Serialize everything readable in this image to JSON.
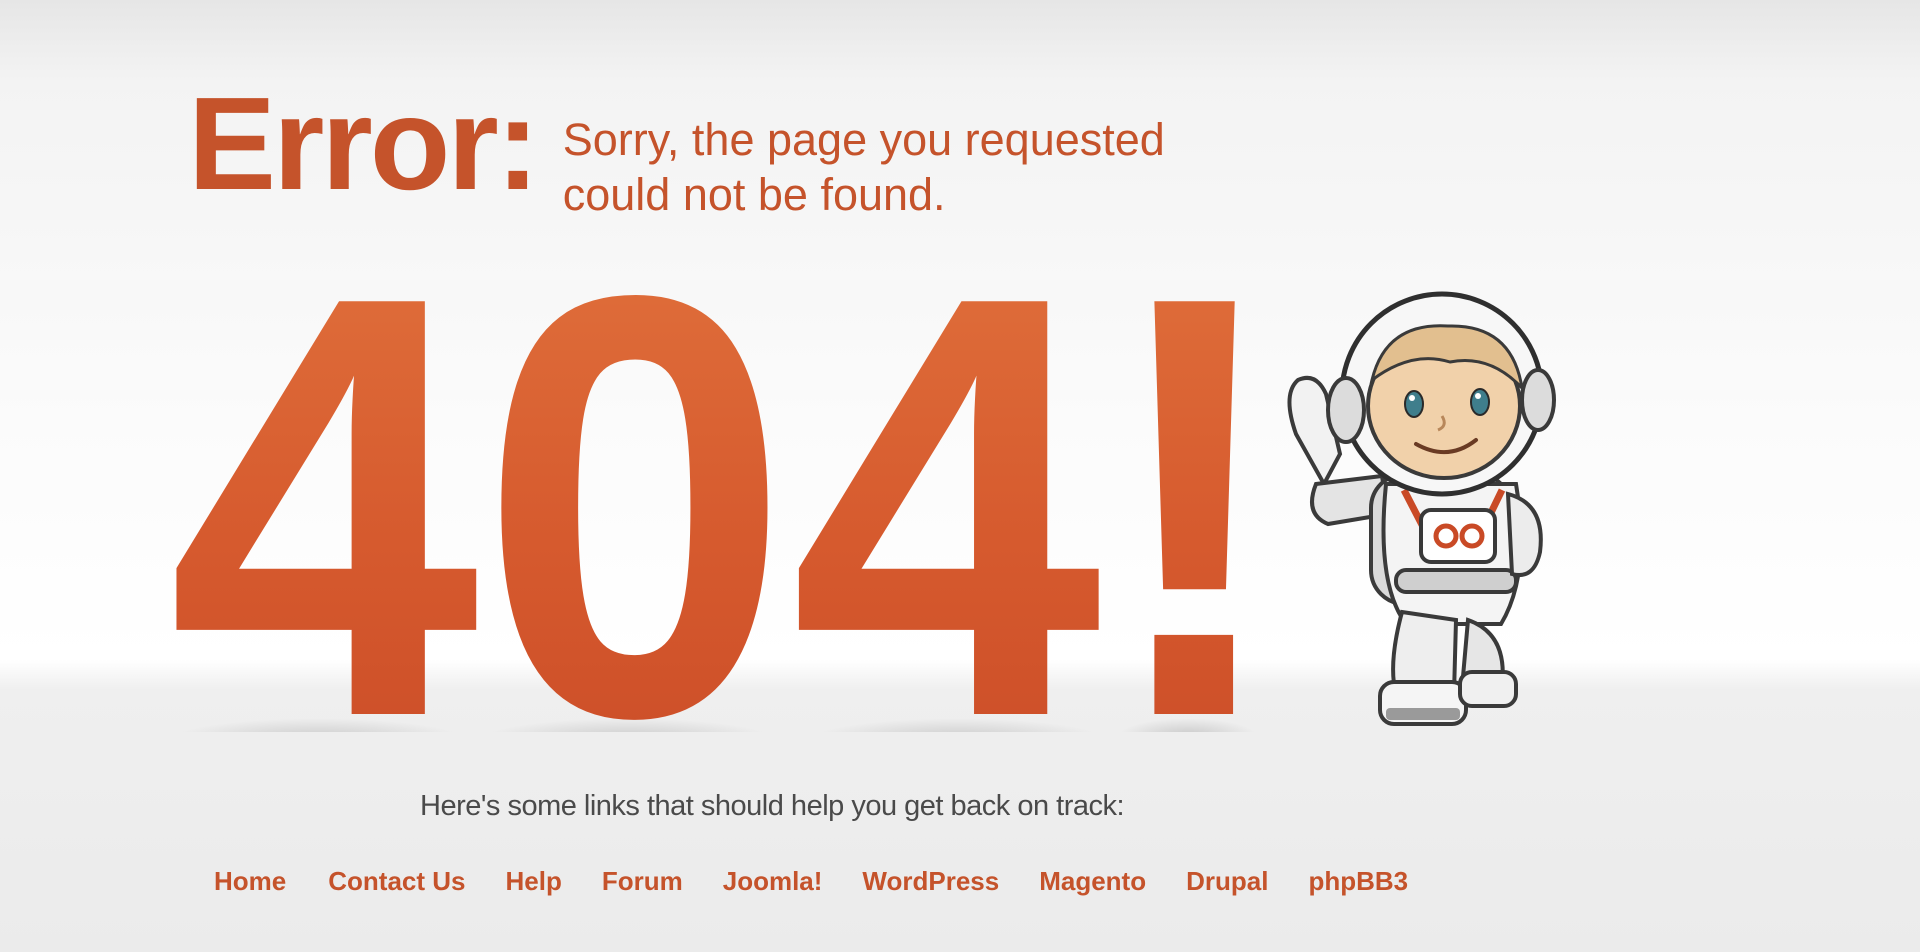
{
  "error": {
    "label": "Error:",
    "message_line1": "Sorry, the page you requested",
    "message_line2": "could not be found."
  },
  "hero": {
    "code": "404!",
    "illustration": "astronaut-mascot"
  },
  "help": {
    "text": "Here's some links that should help you get back on track:"
  },
  "links": [
    {
      "label": "Home"
    },
    {
      "label": "Contact Us"
    },
    {
      "label": "Help"
    },
    {
      "label": "Forum"
    },
    {
      "label": "Joomla!"
    },
    {
      "label": "WordPress"
    },
    {
      "label": "Magento"
    },
    {
      "label": "Drupal"
    },
    {
      "label": "phpBB3"
    }
  ],
  "colors": {
    "accent": "#c5532b",
    "accent_light": "#e2743e",
    "text": "#4a4a4a",
    "background": "#f6f6f6"
  }
}
